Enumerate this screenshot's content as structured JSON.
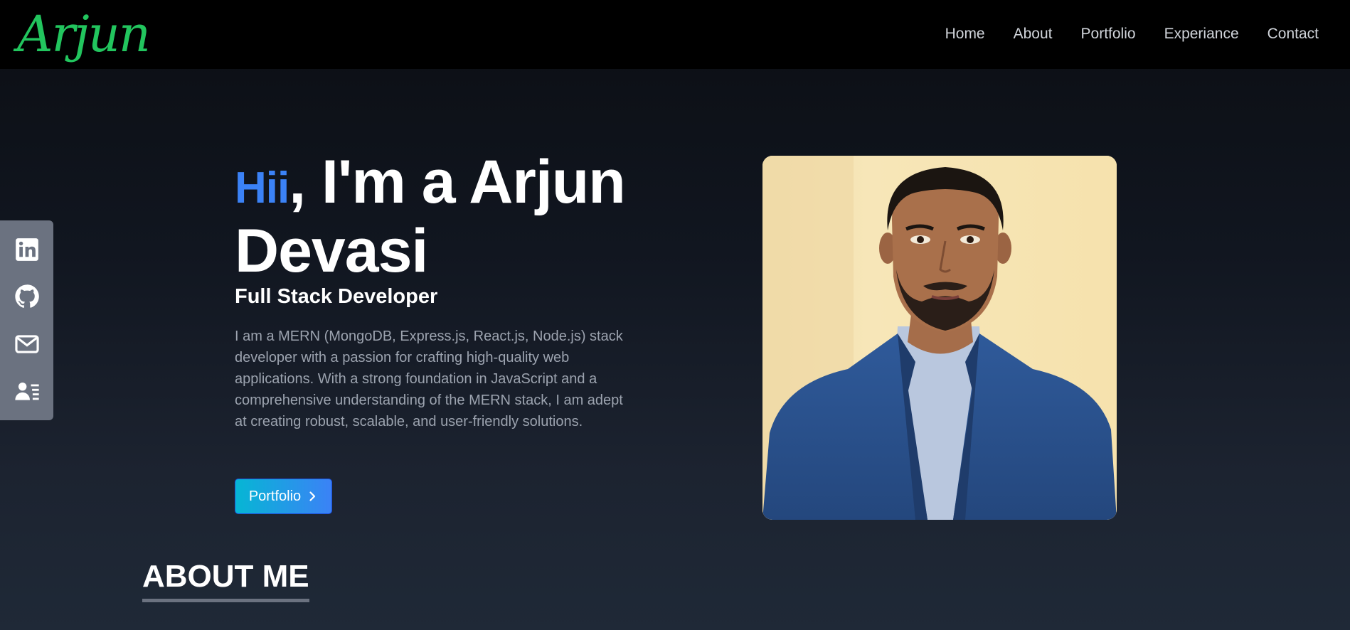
{
  "brand": {
    "logo_text": "Arjun",
    "color": "#22c55e"
  },
  "nav": {
    "items": [
      "Home",
      "About",
      "Portfolio",
      "Experiance",
      "Contact"
    ]
  },
  "social": [
    {
      "icon": "linkedin-icon"
    },
    {
      "icon": "github-icon"
    },
    {
      "icon": "mail-icon"
    },
    {
      "icon": "contact-card-icon"
    }
  ],
  "hero": {
    "greeting": "Hii",
    "heading_rest": ", I'm a Arjun Devasi",
    "role": "Full Stack Developer",
    "description": "I am a MERN (MongoDB, Express.js, React.js, Node.js) stack developer with a passion for crafting high-quality web applications. With a strong foundation in JavaScript and a comprehensive understanding of the MERN stack, I am adept at creating robust, scalable, and user-friendly solutions.",
    "button_label": "Portfolio",
    "accent": "#3b82f6"
  },
  "about": {
    "title": "ABOUT ME"
  },
  "colors": {
    "navbar_bg": "#000000",
    "sidebar_bg": "#6b7280",
    "button_gradient_start": "#06b6d4",
    "button_gradient_end": "#3b82f6"
  }
}
